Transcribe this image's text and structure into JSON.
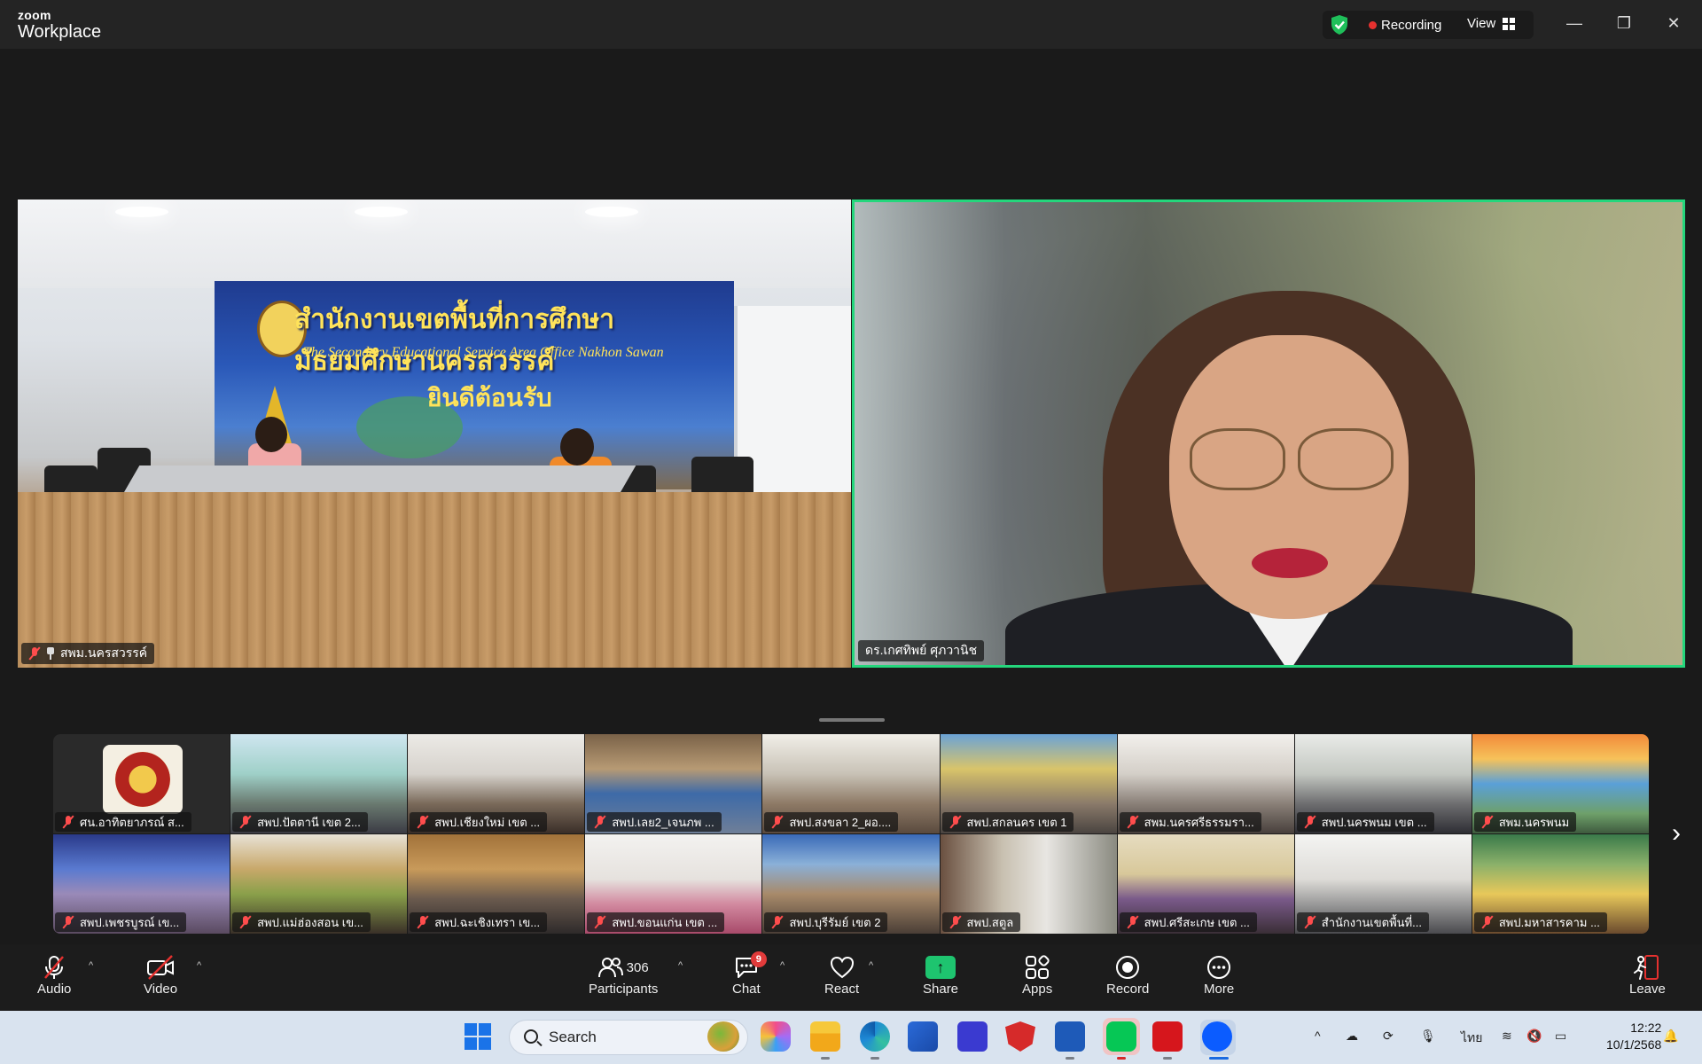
{
  "window": {
    "brand_top": "zoom",
    "brand_bottom": "Workplace",
    "recording_label": "Recording",
    "view_label": "View",
    "minimize_glyph": "—",
    "restore_glyph": "❐",
    "close_glyph": "✕"
  },
  "colors": {
    "active_speaker_border": "#24d67c",
    "recording_dot": "#e5312f",
    "share_button": "#1ec46f",
    "muted": "#ff4d4d"
  },
  "main_videos": [
    {
      "name": "สพม.นครสวรรค์",
      "muted": true,
      "pinned": true
    },
    {
      "name": "ดร.เกศทิพย์ ศุภวานิช",
      "muted": false,
      "active_speaker": true
    }
  ],
  "banner": {
    "title": "สำนักงานเขตพื้นที่การศึกษามัธยมศึกษานครสวรรค์",
    "subtitle": "The Secondary Educational Service Area Office Nakhon Sawan",
    "welcome": "ยินดีต้อนรับ"
  },
  "gallery": [
    {
      "name": "ศน.อาทิตยาภรณ์ ส..."
    },
    {
      "name": "สพป.ปัตตานี เขต 2..."
    },
    {
      "name": "สพป.เชียงใหม่ เขต ..."
    },
    {
      "name": "สพป.เลย2_เจนภพ ..."
    },
    {
      "name": "สพป.สงขลา 2_ผอ...."
    },
    {
      "name": "สพป.สกลนคร เขต 1"
    },
    {
      "name": "สพม.นครศรีธรรมรา..."
    },
    {
      "name": "สพป.นครพนม เขต ..."
    },
    {
      "name": "สพม.นครพนม"
    },
    {
      "name": "สพป.เพชรบูรณ์ เข..."
    },
    {
      "name": "สพป.แม่ฮ่องสอน เข..."
    },
    {
      "name": "สพป.ฉะเชิงเทรา เข..."
    },
    {
      "name": "สพป.ขอนแก่น เขต ..."
    },
    {
      "name": "สพป.บุรีรัมย์ เขต 2"
    },
    {
      "name": "สพป.สตูล"
    },
    {
      "name": "สพป.ศรีสะเกษ เขต ..."
    },
    {
      "name": "สำนักงานเขตพื้นที่..."
    },
    {
      "name": "สพป.มหาสารคาม ..."
    }
  ],
  "toolbar": {
    "audio": "Audio",
    "video": "Video",
    "participants": "Participants",
    "participants_count": "306",
    "chat": "Chat",
    "chat_badge": "9",
    "react": "React",
    "share": "Share",
    "apps": "Apps",
    "record": "Record",
    "more": "More",
    "leave": "Leave"
  },
  "taskbar": {
    "search_placeholder": "Search",
    "language": "ไทย",
    "time": "12:22",
    "date": "10/1/2568"
  }
}
